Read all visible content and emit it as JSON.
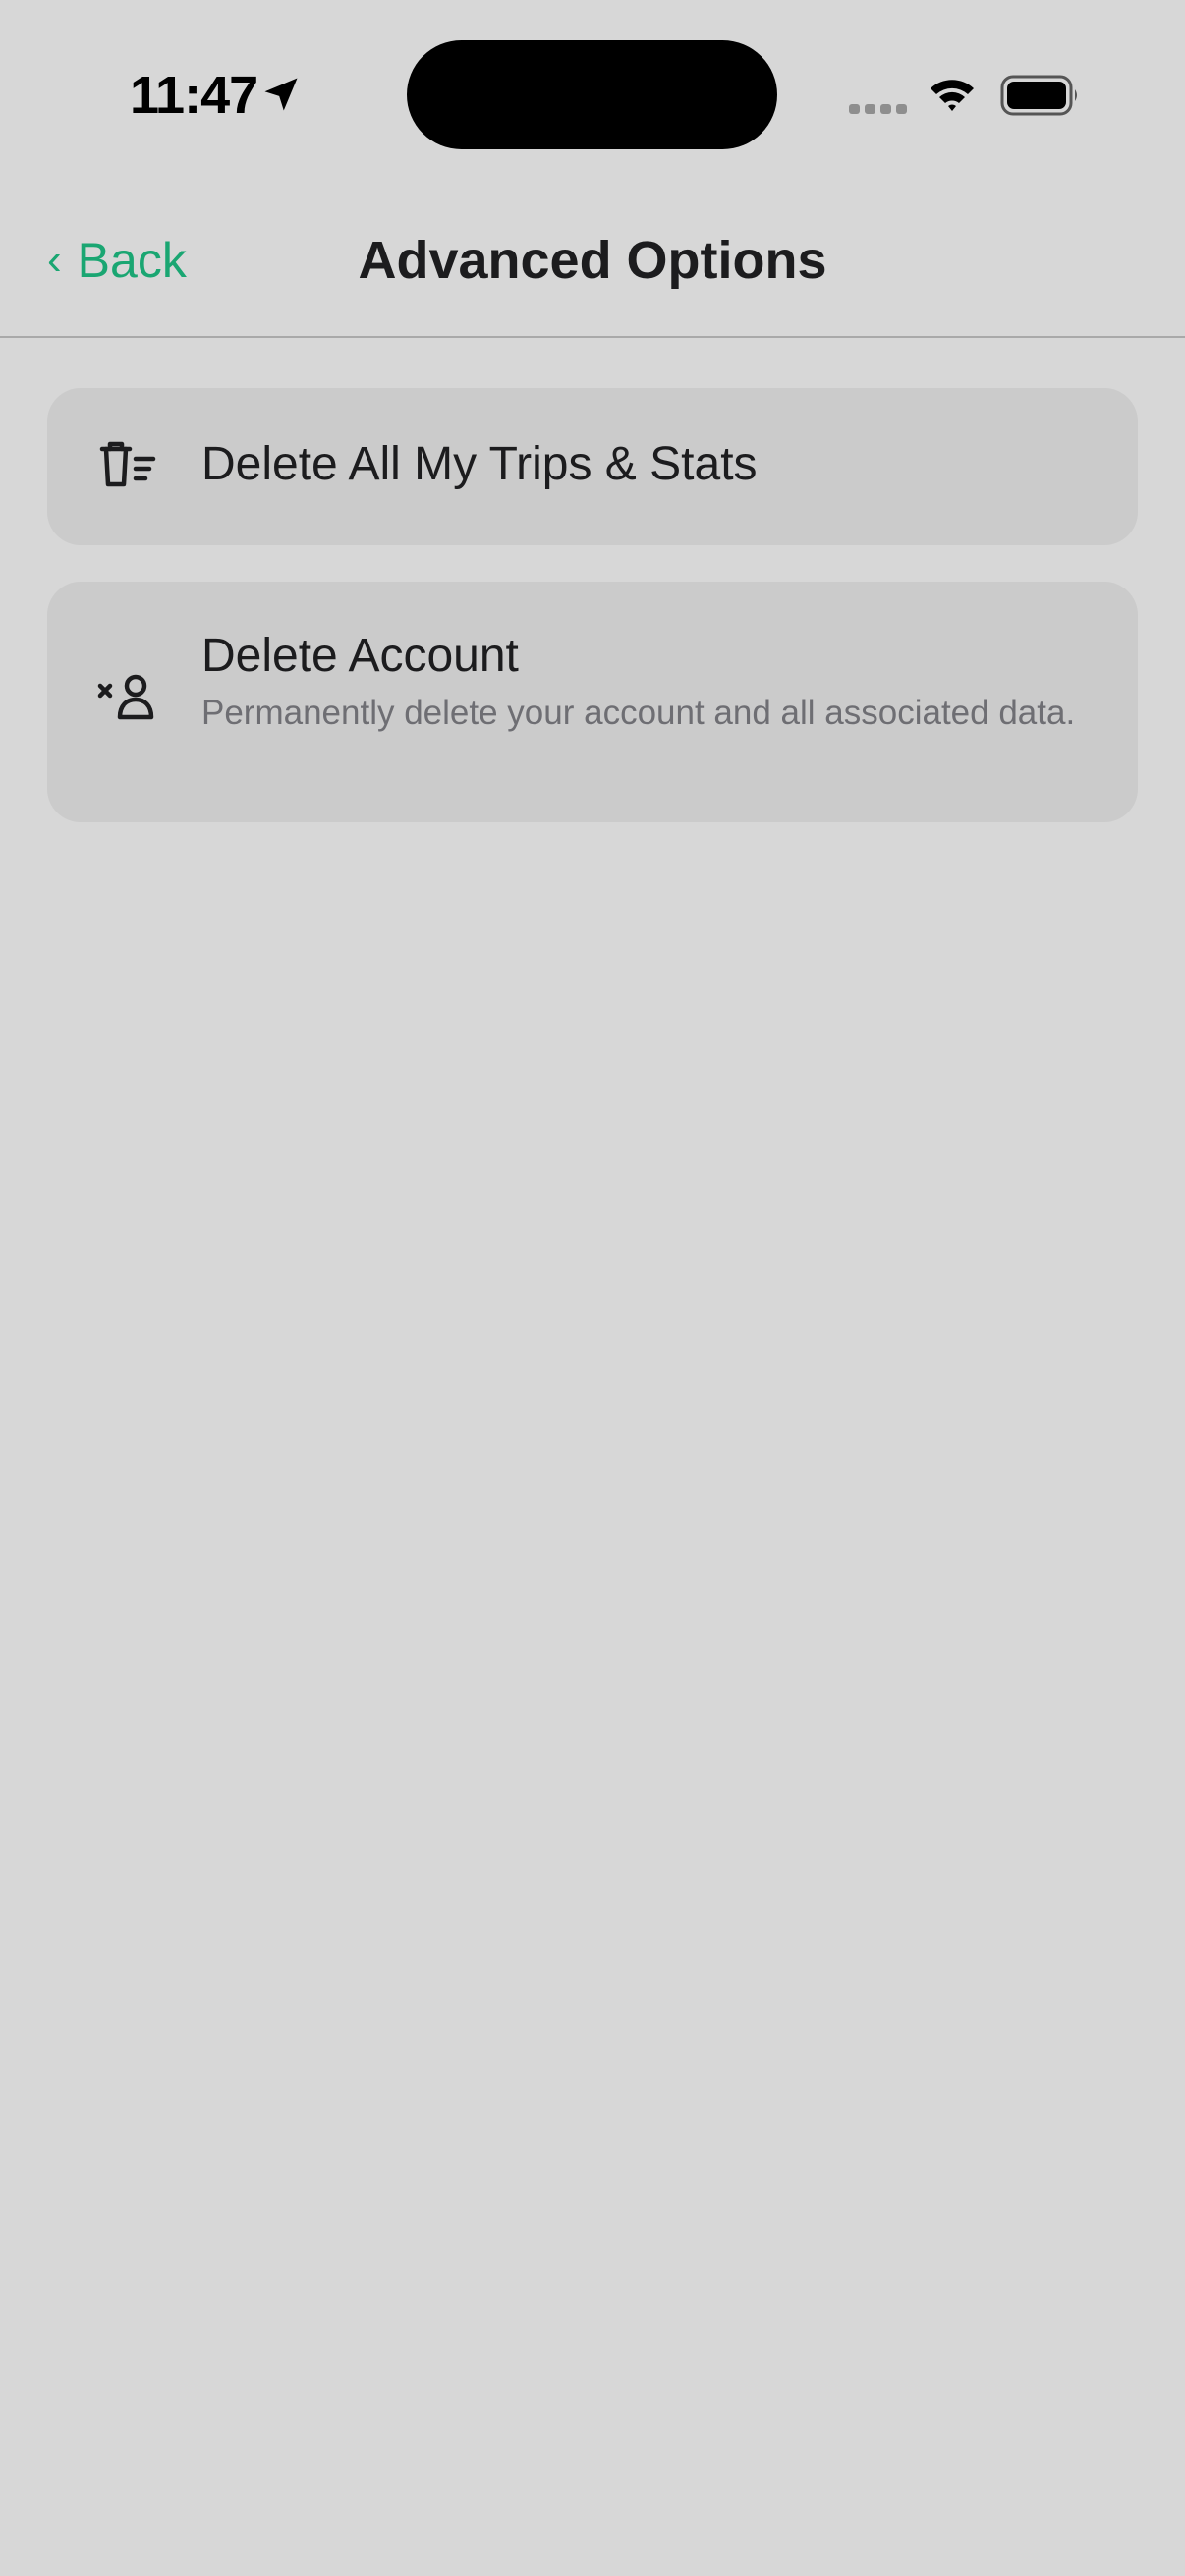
{
  "status_bar": {
    "time": "11:47",
    "icons": [
      "location-arrow-icon",
      "cellular-signal-icon",
      "wifi-icon",
      "battery-icon"
    ]
  },
  "nav": {
    "back_label": "Back",
    "back_chevron": "‹",
    "title": "Advanced Options"
  },
  "options": [
    {
      "icon": "trash-list-icon",
      "title": "Delete All My Trips & Stats"
    },
    {
      "icon": "person-remove-icon",
      "title": "Delete Account",
      "subtitle": "Permanently delete your account and all associated data."
    }
  ],
  "colors": {
    "accent": "#1aa672",
    "background": "#d7d7d7",
    "card": "#cbcbcb",
    "text": "#1c1c1e",
    "secondary_text": "#6e6e73"
  }
}
